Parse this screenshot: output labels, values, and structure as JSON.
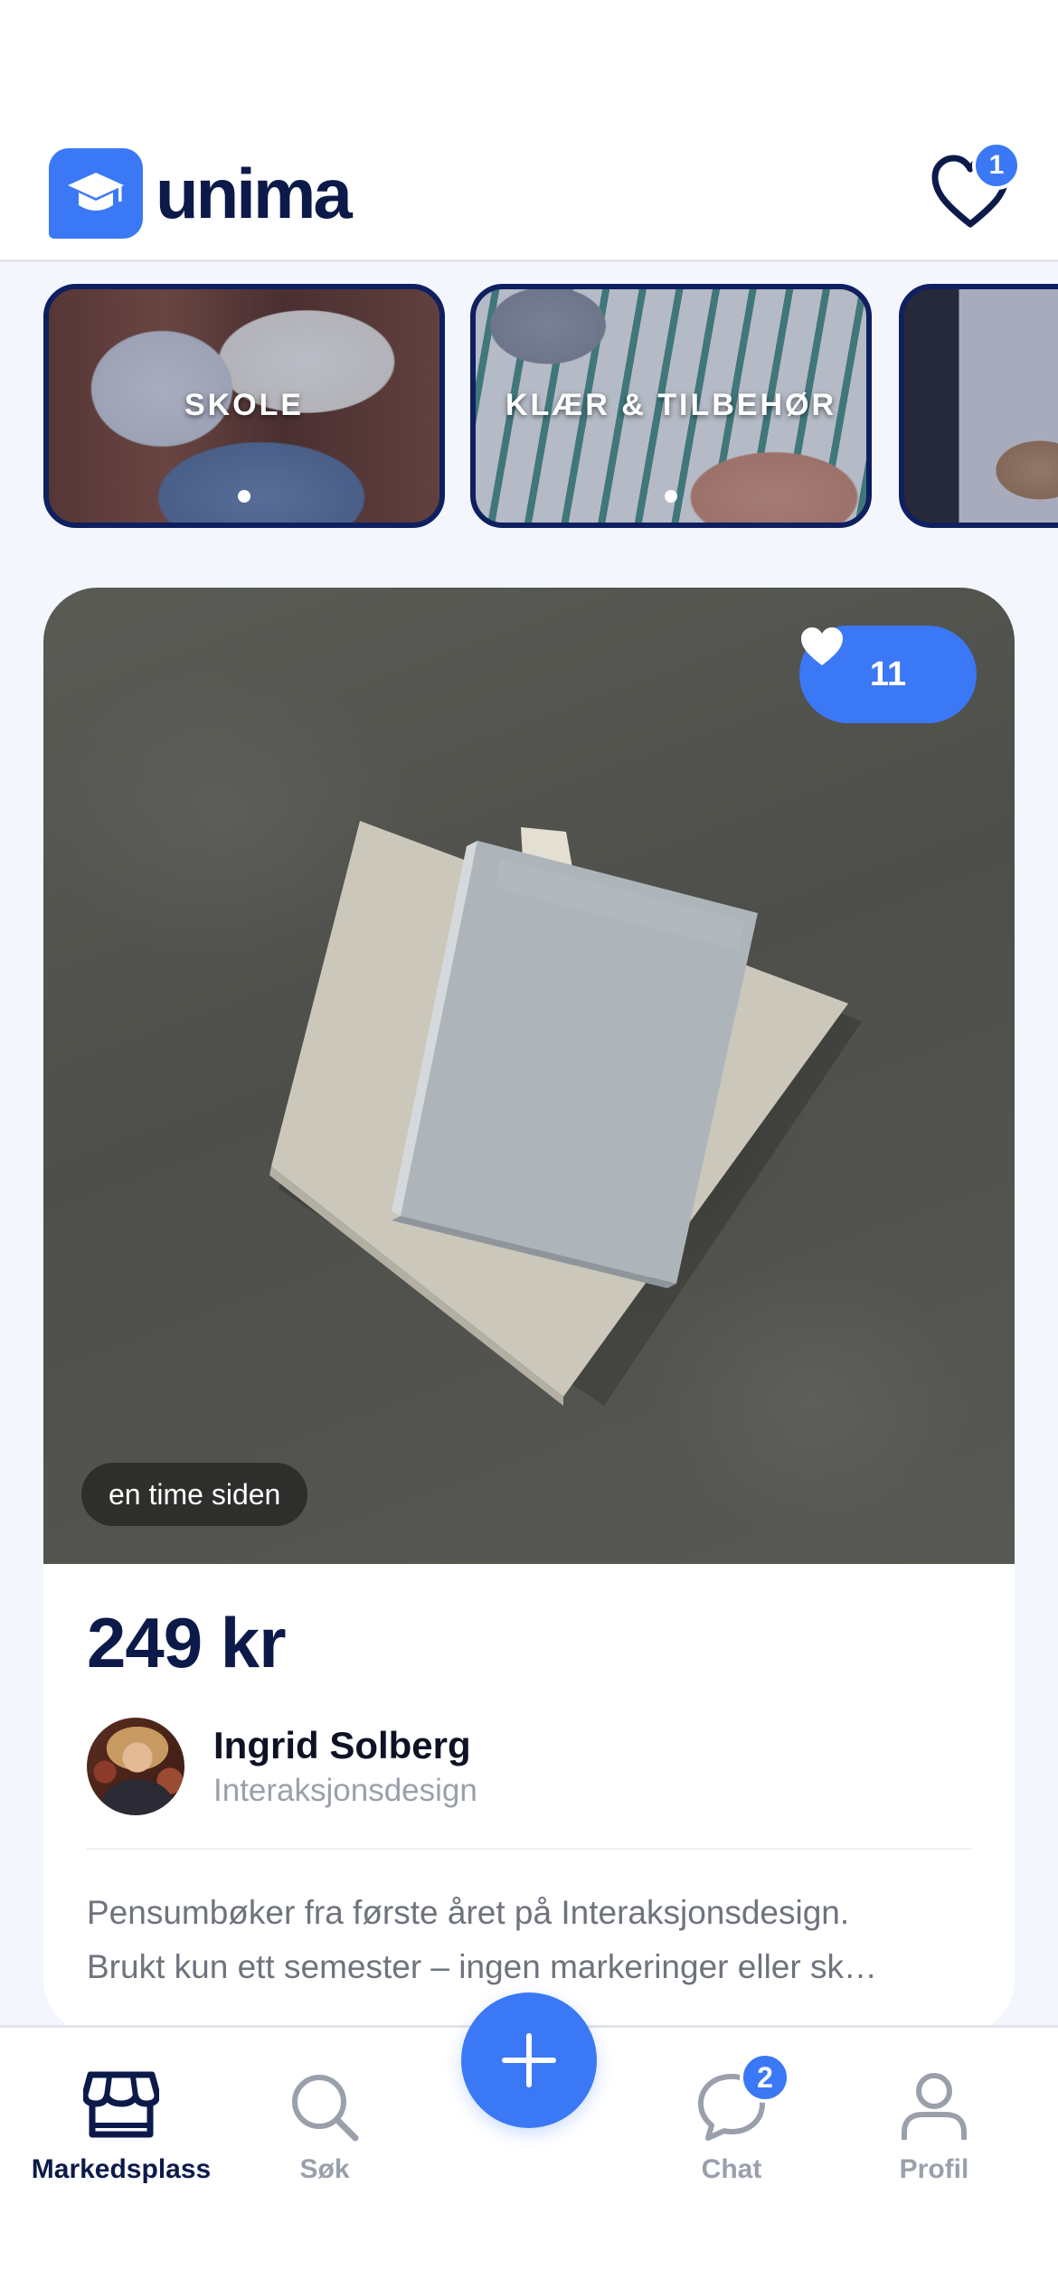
{
  "app": {
    "name": "unima"
  },
  "header": {
    "logo_text": "unima",
    "favorites_badge": "1"
  },
  "categories": [
    {
      "label": "SKOLE"
    },
    {
      "label": "KLÆR & TILBEHØR"
    },
    {
      "label": ""
    }
  ],
  "listing": {
    "likes": "11",
    "posted": "en time siden",
    "price": "249 kr",
    "seller": {
      "name": "Ingrid Solberg",
      "program": "Interaksjonsdesign"
    },
    "description_lines": [
      "Pensumbøker fra første året på Interaksjonsdesign.",
      "Brukt kun ett semester – ingen markeringer eller sk…"
    ]
  },
  "nav": {
    "items": [
      {
        "label": "Markedsplass",
        "icon": "storefront-icon",
        "active": true
      },
      {
        "label": "Søk",
        "icon": "search-icon",
        "active": false
      },
      {
        "label": "Chat",
        "icon": "chat-icon",
        "active": false,
        "badge": "2"
      },
      {
        "label": "Profil",
        "icon": "profile-icon",
        "active": false
      }
    ]
  },
  "colors": {
    "accent": "#3b78f5",
    "navy": "#0c1a4a",
    "background": "#f4f6fd",
    "muted": "#9aa0ab"
  }
}
